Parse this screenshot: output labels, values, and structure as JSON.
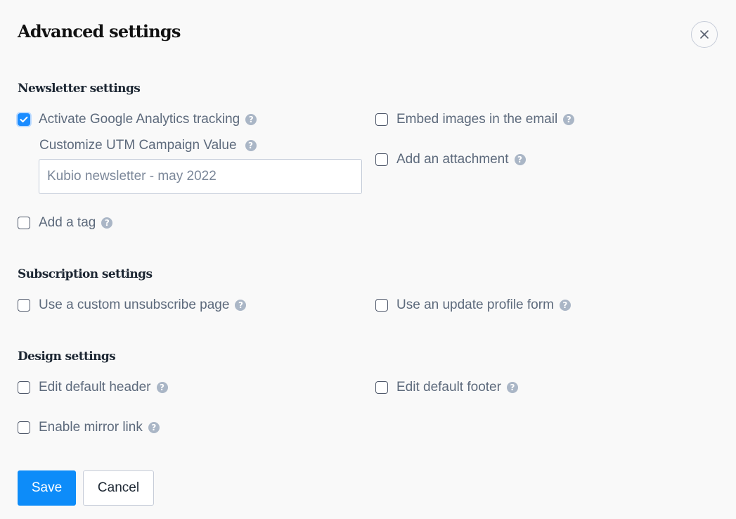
{
  "dialog": {
    "title": "Advanced settings",
    "close_icon": "close-x-icon"
  },
  "newsletter": {
    "title": "Newsletter settings",
    "google_analytics": {
      "label": "Activate Google Analytics tracking",
      "checked": true
    },
    "utm": {
      "label": "Customize UTM Campaign Value",
      "placeholder": "Kubio newsletter - may 2022",
      "value": ""
    },
    "embed_images": {
      "label": "Embed images in the email",
      "checked": false
    },
    "attachment": {
      "label": "Add an attachment",
      "checked": false
    },
    "tag": {
      "label": "Add a tag",
      "checked": false
    }
  },
  "subscription": {
    "title": "Subscription settings",
    "custom_unsubscribe": {
      "label": "Use a custom unsubscribe page",
      "checked": false
    },
    "update_profile": {
      "label": "Use an update profile form",
      "checked": false
    }
  },
  "design": {
    "title": "Design settings",
    "default_header": {
      "label": "Edit default header",
      "checked": false
    },
    "default_footer": {
      "label": "Edit default footer",
      "checked": false
    },
    "mirror_link": {
      "label": "Enable mirror link",
      "checked": false
    }
  },
  "help_glyph": "?",
  "actions": {
    "save_label": "Save",
    "cancel_label": "Cancel"
  },
  "colors": {
    "accent": "#0d8cf9",
    "help_icon": "#aab6c6"
  }
}
